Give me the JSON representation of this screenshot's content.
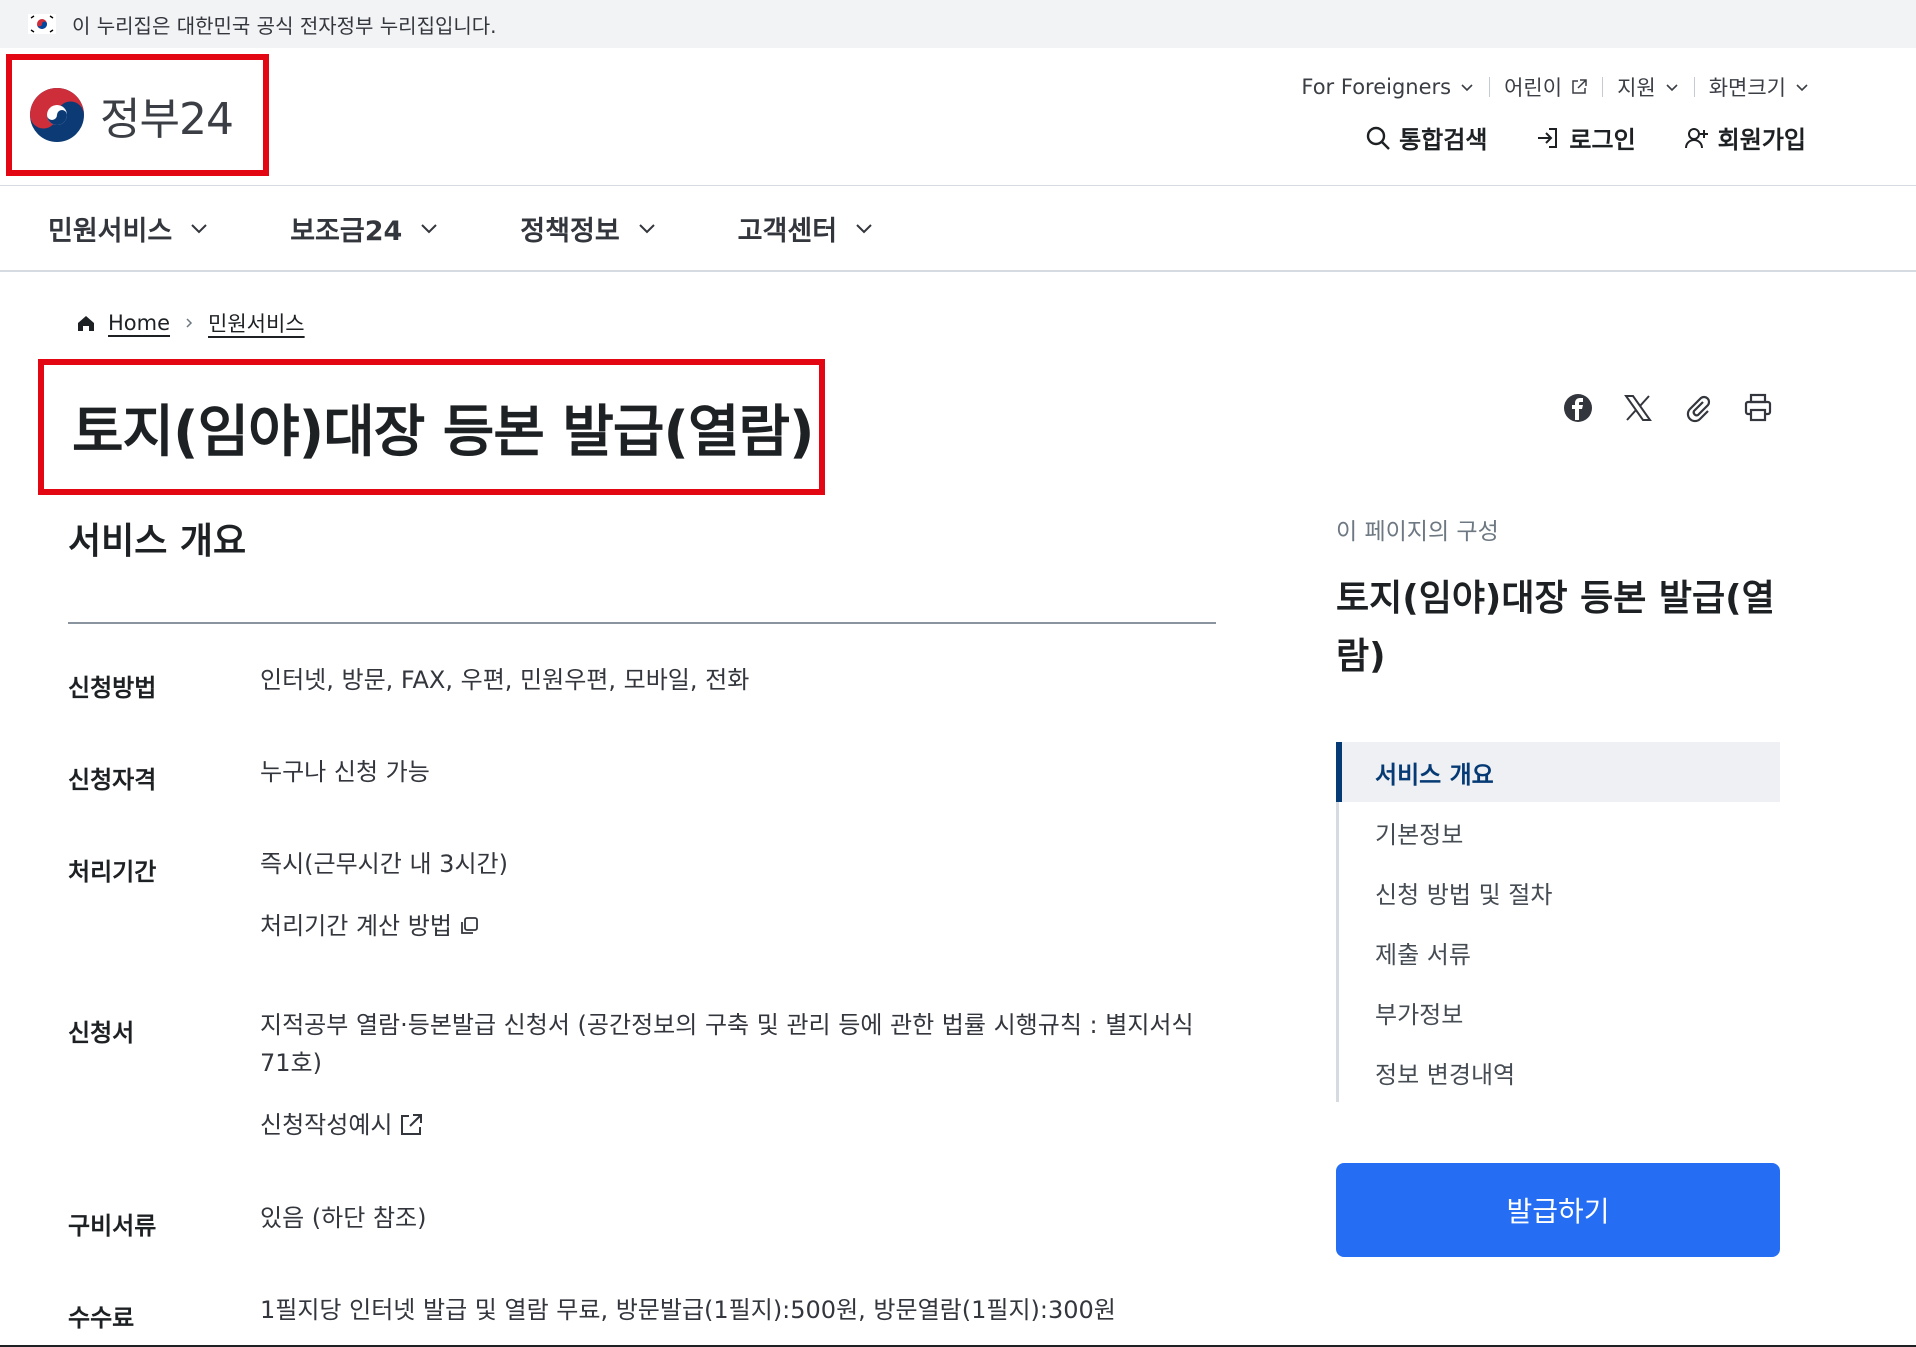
{
  "banner": {
    "text": "이 누리집은 대한민국 공식 전자정부 누리집입니다."
  },
  "header": {
    "logo_text": "정부24",
    "util": [
      {
        "label": "For Foreigners",
        "icon": "chevron-down-icon"
      },
      {
        "label": "어린이",
        "icon": "external-link-icon"
      },
      {
        "label": "지원",
        "icon": "chevron-down-icon"
      },
      {
        "label": "화면크기",
        "icon": "chevron-down-icon"
      }
    ],
    "actions": {
      "search": "통합검색",
      "login": "로그인",
      "signup": "회원가입"
    }
  },
  "nav": [
    {
      "label": "민원서비스"
    },
    {
      "label": "보조금24"
    },
    {
      "label": "정책정보"
    },
    {
      "label": "고객센터"
    }
  ],
  "breadcrumb": {
    "home": "Home",
    "current": "민원서비스"
  },
  "page": {
    "title": "토지(임야)대장 등본 발급(열람)",
    "section_title": "서비스 개요"
  },
  "info": {
    "method": {
      "label": "신청방법",
      "value": "인터넷, 방문, FAX, 우편, 민원우편, 모바일, 전화"
    },
    "eligibility": {
      "label": "신청자격",
      "value": "누구나 신청 가능"
    },
    "period": {
      "label": "처리기간",
      "value": "즉시(근무시간 내 3시간)",
      "sub": "처리기간 계산 방법"
    },
    "form": {
      "label": "신청서",
      "value": "지적공부 열람·등본발급 신청서 (공간정보의 구축 및 관리 등에 관한 법률 시행규칙 : 별지서식 71호)",
      "sub": "신청작성예시"
    },
    "documents": {
      "label": "구비서류",
      "value": "있음 (하단 참조)"
    },
    "fee": {
      "label": "수수료",
      "value": "1필지당 인터넷 발급 및 열람 무료, 방문발급(1필지):500원, 방문열람(1필지):300원"
    }
  },
  "toc": {
    "caption": "이 페이지의 구성",
    "title": "토지(임야)대장 등본 발급(열람)",
    "items": [
      {
        "label": "서비스 개요"
      },
      {
        "label": "기본정보"
      },
      {
        "label": "신청 방법 및 절차"
      },
      {
        "label": "제출 서류"
      },
      {
        "label": "부가정보"
      },
      {
        "label": "정보 변경내역"
      }
    ]
  },
  "issue_button": "발급하기",
  "colors": {
    "accent": "#256ef4",
    "highlight_box": "#e30613",
    "toc_active": "#063a74"
  }
}
